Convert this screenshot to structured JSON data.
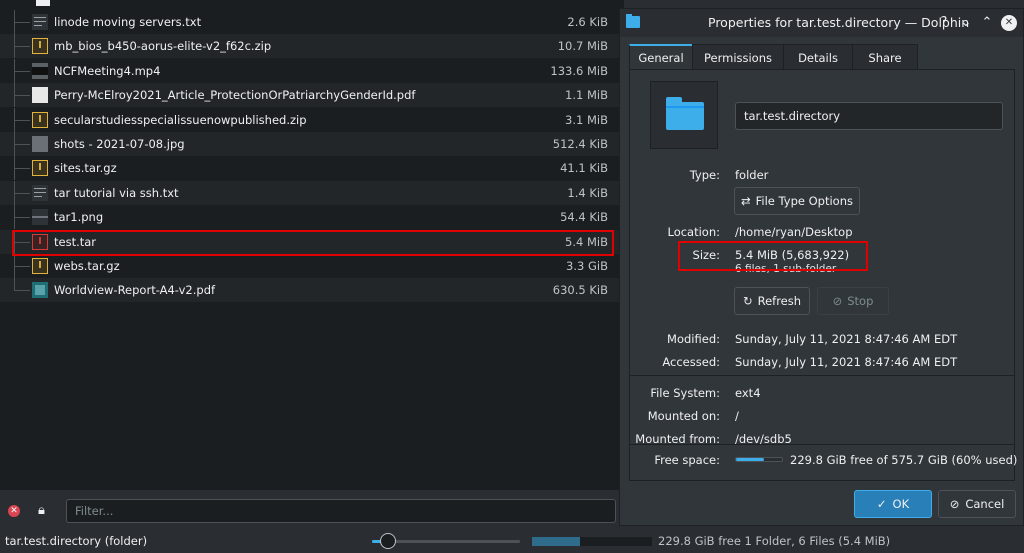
{
  "files": [
    {
      "name": "linode moving servers.txt",
      "size": "2.6 KiB",
      "icon": "text-file-icon"
    },
    {
      "name": "mb_bios_b450-aorus-elite-v2_f62c.zip",
      "size": "10.7 MiB",
      "icon": "archive-icon"
    },
    {
      "name": "NCFMeeting4.mp4",
      "size": "133.6 MiB",
      "icon": "video-icon"
    },
    {
      "name": "Perry-McElroy2021_Article_ProtectionOrPatriarchyGenderId.pdf",
      "size": "1.1 MiB",
      "icon": "pdf-document-icon"
    },
    {
      "name": "secularstudiesspecialissuenowpublished.zip",
      "size": "3.1 MiB",
      "icon": "archive-icon"
    },
    {
      "name": "shots - 2021-07-08.jpg",
      "size": "512.4 KiB",
      "icon": "image-icon"
    },
    {
      "name": "sites.tar.gz",
      "size": "41.1 KiB",
      "icon": "archive-icon"
    },
    {
      "name": "tar tutorial via ssh.txt",
      "size": "1.4 KiB",
      "icon": "text-file-icon"
    },
    {
      "name": "tar1.png",
      "size": "54.4 KiB",
      "icon": "image-icon"
    },
    {
      "name": "test.tar",
      "size": "5.4 MiB",
      "icon": "archive-icon",
      "highlighted": true
    },
    {
      "name": "webs.tar.gz",
      "size": "3.3 GiB",
      "icon": "archive-icon"
    },
    {
      "name": "Worldview-Report-A4-v2.pdf",
      "size": "630.5 KiB",
      "icon": "pdf-document-icon"
    }
  ],
  "filter": {
    "placeholder": "Filter..."
  },
  "status": {
    "text": "tar.test.directory (folder)",
    "space": "229.8 GiB free  1 Folder, 6 Files (5.4 MiB)",
    "free_fraction": 0.4,
    "zoom_fraction": 0.12
  },
  "dialog": {
    "title": "Properties for tar.test.directory — Dolphin",
    "help_glyph": "?",
    "tabs": [
      "General",
      "Permissions",
      "Details",
      "Share"
    ],
    "name_value": "tar.test.directory",
    "type_label": "Type:",
    "type_value": "folder",
    "file_type_options": "File Type Options",
    "location_label": "Location:",
    "location_value": "/home/ryan/Desktop",
    "size_label": "Size:",
    "size_value": "5.4 MiB (5,683,922)",
    "contents_value": "6 files, 1 sub-folder",
    "refresh_label": "Refresh",
    "stop_label": "Stop",
    "modified_label": "Modified:",
    "modified_value": "Sunday, July 11, 2021 8:47:46 AM EDT",
    "accessed_label": "Accessed:",
    "accessed_value": "Sunday, July 11, 2021 8:47:46 AM EDT",
    "filesystem_label": "File System:",
    "filesystem_value": "ext4",
    "mounted_on_label": "Mounted on:",
    "mounted_on_value": "/",
    "mounted_from_label": "Mounted from:",
    "mounted_from_value": "/dev/sdb5",
    "free_space_label": "Free space:",
    "free_space_value": "229.8 GiB free of 575.7 GiB (60% used)",
    "used_fraction": 0.6,
    "ok_label": "OK",
    "cancel_label": "Cancel"
  },
  "colors": {
    "accent": "#3daee9",
    "highlight": "#e00000",
    "background": "#31363b"
  }
}
